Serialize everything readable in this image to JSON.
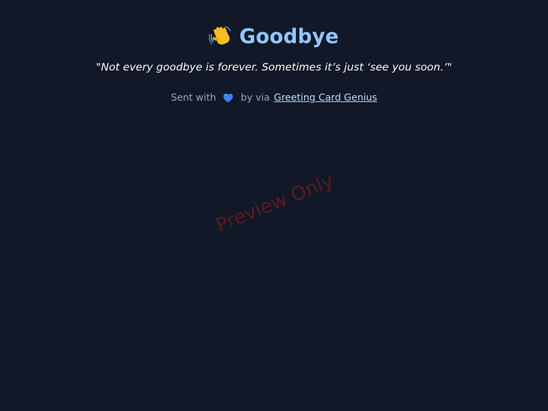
{
  "card": {
    "title": "Goodbye",
    "title_icon": "waving-hand-icon",
    "message": "\"Not every goodbye is forever. Sometimes it’s just ‘see you soon.’\"",
    "footer": {
      "sent_with": "Sent with",
      "heart_icon": "blue-heart-icon",
      "by_via": "by via",
      "link_text": "Greeting Card Genius"
    }
  },
  "watermark": "Preview Only",
  "colors": {
    "background": "#111827",
    "title": "#93c5fd",
    "link": "#bfdbfe",
    "muted": "#9ca3af",
    "heart": "#3b82f6",
    "watermark": "#b91c1c"
  }
}
